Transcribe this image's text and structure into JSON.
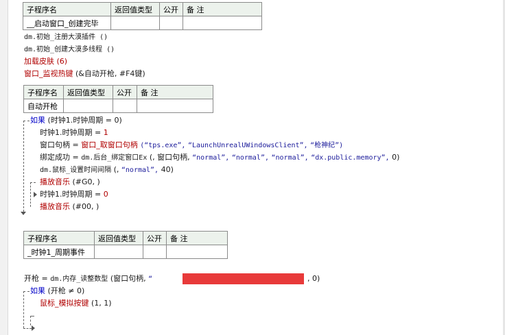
{
  "table1": {
    "headers": [
      "子程序名",
      "返回值类型",
      "公开",
      "备 注"
    ],
    "row": [
      "__启动窗口_创建完毕",
      "",
      "",
      ""
    ]
  },
  "lines1": {
    "l1": "dm.初始_注册大漠插件 ()",
    "l2": "dm.初始_创建大漠多线程 ()",
    "l3_fn": "加载皮肤",
    "l3_args": "(6)",
    "l4_fn": "窗口_监视热键",
    "l4_args": "(&自动开枪, #F4键)"
  },
  "table2": {
    "headers": [
      "子程序名",
      "返回值类型",
      "公开",
      "备 注"
    ],
    "row": [
      "自动开枪",
      "",
      "",
      ""
    ]
  },
  "code2": {
    "if1_kw": "如果",
    "if1_cond": "(时钟1.时钟周期 = 0)",
    "a1_lhs": "时钟1.时钟周期 =",
    "a1_rhs": "1",
    "a2_lhs": "窗口句柄 =",
    "a2_fn": "窗口_取窗口句柄",
    "a2_s1": "(“tps.exe”,",
    "a2_s2": "“LaunchUnrealUWindowsClient”,",
    "a2_s3": "“枪神纪”)",
    "a3_lhs": "绑定成功 =",
    "a3_fn": "dm.后台_绑定窗口Ex",
    "a3_a1": "(, 窗口句柄,",
    "a3_s1": "“normal”,",
    "a3_s2": "“normal”,",
    "a3_s3": "“normal”,",
    "a3_s4": "“dx.public.memory”,",
    "a3_end": "0)",
    "a4_fn": "dm.鼠标_设置时间间隔",
    "a4_a1": "(,",
    "a4_s1": "“normal”,",
    "a4_end": "40)",
    "a5_fn": "播放音乐",
    "a5_args": "(#G0, )",
    "a6_lhs": "时钟1.时钟周期 =",
    "a6_rhs": "0",
    "a7_fn": "播放音乐",
    "a7_args": "(#00, )"
  },
  "table3": {
    "headers": [
      "子程序名",
      "返回值类型",
      "公开",
      "备 注"
    ],
    "row": [
      "_时钟1_周期事件",
      "",
      "",
      ""
    ]
  },
  "code3": {
    "b1_lhs": "开枪 =",
    "b1_fn": "dm.内存_读整数型",
    "b1_a1": "(窗口句柄,",
    "b1_q": "“",
    "b1_end": ", 0)",
    "if2_kw": "如果",
    "if2_cond": "(开枪 ≠ 0)",
    "b2_fn": "鼠标_模拟按键",
    "b2_args": "(1, 1)"
  }
}
